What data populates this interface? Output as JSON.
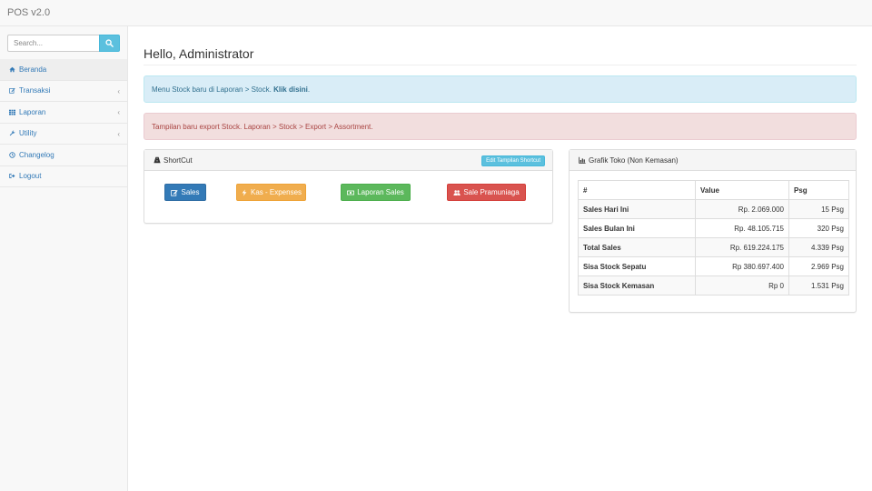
{
  "app": {
    "title": "POS v2.0"
  },
  "sidebar": {
    "search": {
      "placeholder": "Search..."
    },
    "items": [
      {
        "label": "Beranda",
        "icon": "home-icon"
      },
      {
        "label": "Transaksi",
        "icon": "edit-icon"
      },
      {
        "label": "Laporan",
        "icon": "grid-icon"
      },
      {
        "label": "Utility",
        "icon": "gear-icon"
      },
      {
        "label": "Changelog",
        "icon": "clock-icon"
      },
      {
        "label": "Logout",
        "icon": "logout-icon"
      }
    ]
  },
  "main": {
    "title": "Hello, Administrator",
    "alerts": {
      "info_text": "Menu Stock baru di Laporan > Stock. ",
      "info_link": "Klik disini",
      "info_suffix": ".",
      "danger_text": "Tampilan baru export Stock. Laporan > Stock > Export > Assortment."
    },
    "shortcut": {
      "title": "ShortCut",
      "edit_label": "Edit Tampilan Shortcut",
      "buttons": [
        {
          "label": "Sales",
          "icon": "edit-icon",
          "color": "#337ab7"
        },
        {
          "label": "Kas - Expenses",
          "icon": "bolt-icon",
          "color": "#f0ad4e"
        },
        {
          "label": "Laporan Sales",
          "icon": "money-icon",
          "color": "#5cb85c"
        },
        {
          "label": "Sale Pramuniaga",
          "icon": "users-icon",
          "color": "#d9534f"
        }
      ]
    },
    "grafik": {
      "title": "Grafik Toko (Non Kemasan)",
      "headers": [
        "#",
        "Value",
        "Psg"
      ],
      "rows": [
        {
          "label": "Sales Hari Ini",
          "value": "Rp. 2.069.000",
          "psg": "15 Psg"
        },
        {
          "label": "Sales Bulan Ini",
          "value": "Rp. 48.105.715",
          "psg": "320 Psg"
        },
        {
          "label": "Total Sales",
          "value": "Rp. 619.224.175",
          "psg": "4.339 Psg"
        },
        {
          "label": "Sisa Stock Sepatu",
          "value": "Rp 380.697.400",
          "psg": "2.969 Psg"
        },
        {
          "label": "Sisa Stock Kemasan",
          "value": "Rp 0",
          "psg": "1.531 Psg"
        }
      ]
    }
  }
}
